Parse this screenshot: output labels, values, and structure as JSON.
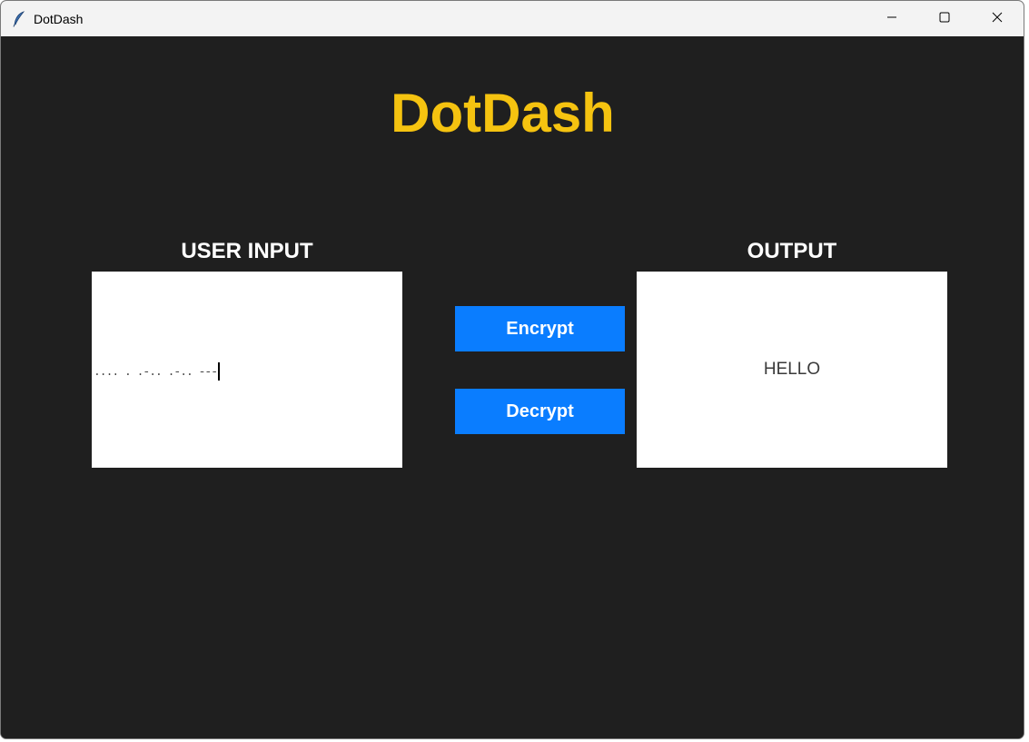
{
  "window": {
    "title": "DotDash"
  },
  "app": {
    "heading": "DotDash",
    "input_label": "USER INPUT",
    "output_label": "OUTPUT",
    "input_value": ".... . .-.. .-.. ---",
    "output_value": "HELLO",
    "encrypt_label": "Encrypt",
    "decrypt_label": "Decrypt"
  },
  "colors": {
    "background": "#1f1f1f",
    "heading": "#f5c310",
    "button": "#0a7dff",
    "label": "#ffffff"
  },
  "icons": {
    "app": "feather-icon",
    "minimize": "minimize-icon",
    "maximize": "maximize-icon",
    "close": "close-icon"
  }
}
